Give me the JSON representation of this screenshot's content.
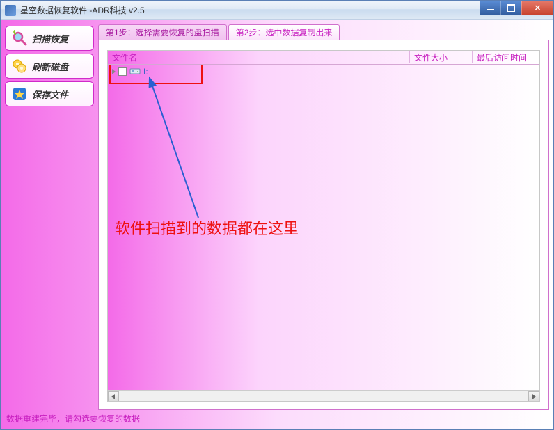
{
  "titlebar": {
    "title": "星空数据恢复软件   -ADR科技 v2.5"
  },
  "sidebar": {
    "buttons": [
      {
        "label": "扫描恢复",
        "name": "scan-recover-button",
        "icon": "magnify"
      },
      {
        "label": "刷新磁盘",
        "name": "refresh-disk-button",
        "icon": "refresh"
      },
      {
        "label": "保存文件",
        "name": "save-file-button",
        "icon": "save"
      }
    ]
  },
  "tabs": {
    "items": [
      {
        "label": "第1步：选择需要恢复的盘扫描",
        "active": false
      },
      {
        "label": "第2步：选中数据复制出来",
        "active": true
      }
    ]
  },
  "list": {
    "headers": {
      "name": "文件名",
      "size": "文件大小",
      "time": "最后访问时间"
    },
    "rows": [
      {
        "label": "I:"
      }
    ]
  },
  "annotation": {
    "text": "软件扫描到的数据都在这里"
  },
  "statusbar": {
    "text": "数据重建完毕，请勾选要恢复的数据"
  }
}
